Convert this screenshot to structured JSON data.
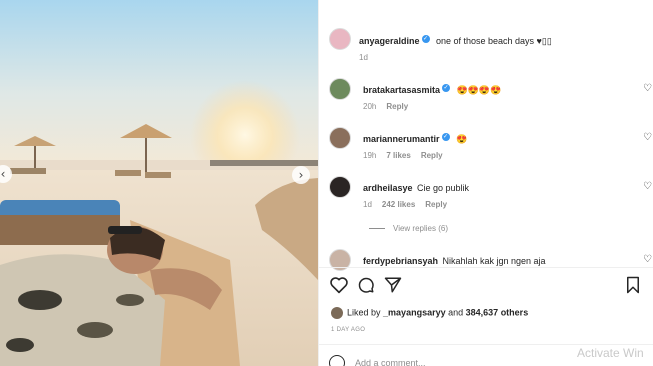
{
  "post": {
    "author": "anyageraldine",
    "caption": "one of those beach days ♥▯▯",
    "time": "1d"
  },
  "comments": [
    {
      "user": "bratakartasasmita",
      "text": "😍😍😍😍",
      "time": "20h",
      "likes": "",
      "reply": "Reply",
      "verified": true
    },
    {
      "user": "mariannerumantir",
      "text": "😍",
      "time": "19h",
      "likes": "7 likes",
      "reply": "Reply",
      "verified": true
    },
    {
      "user": "ardheilasye",
      "text": "Cie go publik",
      "time": "1d",
      "likes": "242 likes",
      "reply": "Reply",
      "verified": false
    },
    {
      "user": "ferdypebriansyah",
      "text": "Nikahlah kak jgn ngen aja",
      "time": "",
      "likes": "",
      "reply": "",
      "verified": false
    }
  ],
  "view_replies": "View replies (6)",
  "likes": {
    "prefix": "Liked by",
    "first_user": "_mayangsaryy",
    "joiner": "and",
    "count": "384,637 others"
  },
  "time_ago": "1 DAY AGO",
  "add_comment_placeholder": "Add a comment...",
  "watermark": "Activate Win",
  "colors": {
    "verified": "#3897f0",
    "muted": "#8e8e8e",
    "text": "#262626"
  }
}
